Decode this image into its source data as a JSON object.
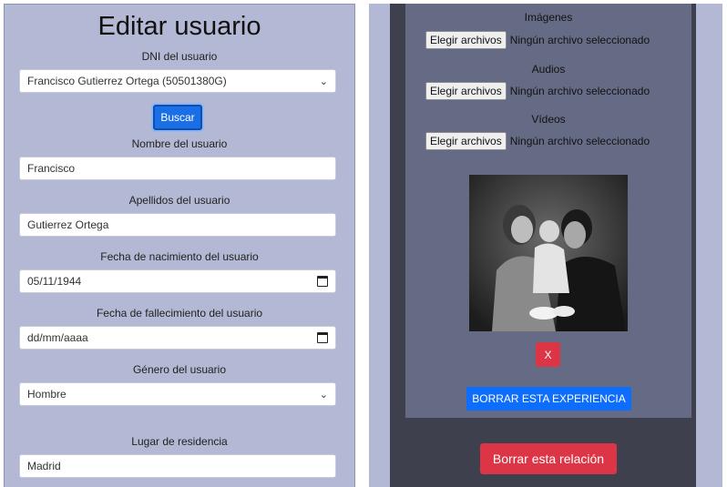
{
  "edit_form": {
    "title": "Editar usuario",
    "dni_label": "DNI del usuario",
    "dni_selected": "Francisco Gutierrez Ortega (50501380G)",
    "search_button": "Buscar",
    "name_label": "Nombre del usuario",
    "name_value": "Francisco",
    "surname_label": "Apellidos del usuario",
    "surname_value": "Gutierrez Ortega",
    "birth_label": "Fecha de nacimiento del usuario",
    "birth_value": "05/11/1944",
    "death_label": "Fecha de fallecimiento del usuario",
    "death_placeholder": "dd/mm/aaaa",
    "gender_label": "Género del usuario",
    "gender_selected": "Hombre",
    "residence_label": "Lugar de residencia",
    "residence_value": "Madrid"
  },
  "experience": {
    "images_label": "Imágenes",
    "audios_label": "Audios",
    "videos_label": "Vídeos",
    "choose_file_label": "Elegir archivos",
    "no_file_label": "Ningún archivo seleccionado",
    "remove_photo_label": "X",
    "delete_experience_label": "BORRAR ESTA EXPERIENCIA",
    "delete_relation_label": "Borrar esta relación"
  },
  "icons": {
    "select_arrow": "chevron-down-icon",
    "date_picker": "calendar-icon"
  },
  "colors": {
    "panel_bg": "#b3b8d4",
    "card_bg": "#666b85",
    "dark_bg": "#3f404d",
    "primary": "#0d6efd",
    "danger": "#dc3545"
  }
}
